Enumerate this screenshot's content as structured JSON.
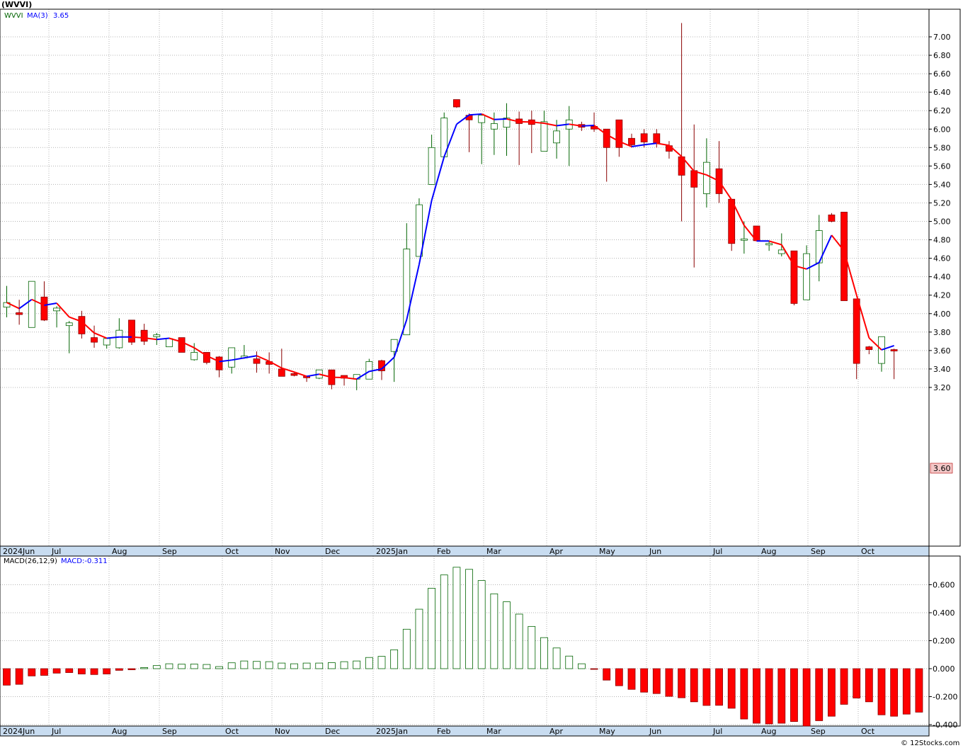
{
  "header": {
    "symbol": "(WVVI)"
  },
  "price_panel": {
    "legend_symbol": "WVVI",
    "legend_ma": "MA(3)",
    "legend_ma_value": "3.65",
    "last_price_tag": "3.60",
    "y_ticks": [
      "3.20",
      "3.40",
      "3.60",
      "3.80",
      "4.00",
      "4.20",
      "4.40",
      "4.60",
      "4.80",
      "5.00",
      "5.20",
      "5.40",
      "5.60",
      "5.80",
      "6.00",
      "6.20",
      "6.40",
      "6.60",
      "6.80",
      "7.00"
    ]
  },
  "macd_panel": {
    "legend_name": "MACD(26,12,9)",
    "legend_value": "MACD:-0.311",
    "y_ticks": [
      "-0.400",
      "-0.200",
      "0.000",
      "0.200",
      "0.400",
      "0.600"
    ]
  },
  "x_axis_labels": [
    "2024Jun",
    "Jul",
    "Aug",
    "Sep",
    "Oct",
    "Nov",
    "Dec",
    "2025Jan",
    "Feb",
    "Mar",
    "Apr",
    "May",
    "Jun",
    "Jul",
    "Aug",
    "Sep",
    "Oct"
  ],
  "footer": {
    "credit": "© 12Stocks.com"
  },
  "colors": {
    "up_candle": "#006400",
    "down_candle": "#ff0000",
    "ma_up": "#0000ff",
    "ma_down": "#ff0000",
    "grid": "#b4b4b4",
    "axis_band": "#c8dcf0",
    "price_tag": "#f4c8c8"
  },
  "chart_data": [
    {
      "type": "candlestick",
      "title": "(WVVI)",
      "series_name": "WVVI",
      "ylim": [
        3.15,
        7.25
      ],
      "ma_period": 3,
      "candles": [
        {
          "o": 4.07,
          "h": 4.3,
          "l": 3.96,
          "c": 4.12
        },
        {
          "o": 4.01,
          "h": 4.15,
          "l": 3.88,
          "c": 3.99
        },
        {
          "o": 3.85,
          "h": 4.35,
          "l": 3.85,
          "c": 4.35
        },
        {
          "o": 4.18,
          "h": 4.35,
          "l": 3.92,
          "c": 3.93
        },
        {
          "o": 4.03,
          "h": 4.08,
          "l": 3.85,
          "c": 4.06
        },
        {
          "o": 3.87,
          "h": 3.92,
          "l": 3.57,
          "c": 3.9
        },
        {
          "o": 3.97,
          "h": 4.03,
          "l": 3.73,
          "c": 3.78
        },
        {
          "o": 3.74,
          "h": 3.87,
          "l": 3.63,
          "c": 3.69
        },
        {
          "o": 3.66,
          "h": 3.74,
          "l": 3.62,
          "c": 3.73
        },
        {
          "o": 3.63,
          "h": 3.95,
          "l": 3.62,
          "c": 3.82
        },
        {
          "o": 3.93,
          "h": 3.93,
          "l": 3.66,
          "c": 3.69
        },
        {
          "o": 3.82,
          "h": 3.89,
          "l": 3.66,
          "c": 3.7
        },
        {
          "o": 3.75,
          "h": 3.79,
          "l": 3.66,
          "c": 3.77
        },
        {
          "o": 3.64,
          "h": 3.74,
          "l": 3.64,
          "c": 3.73
        },
        {
          "o": 3.74,
          "h": 3.74,
          "l": 3.58,
          "c": 3.58
        },
        {
          "o": 3.5,
          "h": 3.68,
          "l": 3.49,
          "c": 3.58
        },
        {
          "o": 3.58,
          "h": 3.58,
          "l": 3.45,
          "c": 3.47
        },
        {
          "o": 3.53,
          "h": 3.54,
          "l": 3.31,
          "c": 3.39
        },
        {
          "o": 3.42,
          "h": 3.63,
          "l": 3.35,
          "c": 3.63
        },
        {
          "o": 3.52,
          "h": 3.66,
          "l": 3.51,
          "c": 3.54
        },
        {
          "o": 3.51,
          "h": 3.59,
          "l": 3.36,
          "c": 3.46
        },
        {
          "o": 3.48,
          "h": 3.58,
          "l": 3.35,
          "c": 3.45
        },
        {
          "o": 3.4,
          "h": 3.62,
          "l": 3.32,
          "c": 3.32
        },
        {
          "o": 3.35,
          "h": 3.37,
          "l": 3.32,
          "c": 3.33
        },
        {
          "o": 3.32,
          "h": 3.33,
          "l": 3.26,
          "c": 3.31
        },
        {
          "o": 3.3,
          "h": 3.39,
          "l": 3.29,
          "c": 3.39
        },
        {
          "o": 3.39,
          "h": 3.39,
          "l": 3.18,
          "c": 3.23
        },
        {
          "o": 3.33,
          "h": 3.33,
          "l": 3.22,
          "c": 3.3
        },
        {
          "o": 3.29,
          "h": 3.34,
          "l": 3.17,
          "c": 3.34
        },
        {
          "o": 3.29,
          "h": 3.51,
          "l": 3.29,
          "c": 3.48
        },
        {
          "o": 3.49,
          "h": 3.5,
          "l": 3.28,
          "c": 3.38
        },
        {
          "o": 3.59,
          "h": 3.72,
          "l": 3.26,
          "c": 3.72
        },
        {
          "o": 3.77,
          "h": 4.98,
          "l": 3.77,
          "c": 4.7
        },
        {
          "o": 4.62,
          "h": 5.25,
          "l": 4.62,
          "c": 5.18
        },
        {
          "o": 5.4,
          "h": 5.94,
          "l": 5.4,
          "c": 5.8
        },
        {
          "o": 5.7,
          "h": 6.18,
          "l": 5.7,
          "c": 6.12
        },
        {
          "o": 6.32,
          "h": 6.32,
          "l": 6.23,
          "c": 6.24
        },
        {
          "o": 6.15,
          "h": 6.17,
          "l": 5.75,
          "c": 6.1
        },
        {
          "o": 6.07,
          "h": 6.16,
          "l": 5.62,
          "c": 6.15
        },
        {
          "o": 6.0,
          "h": 6.18,
          "l": 5.72,
          "c": 6.06
        },
        {
          "o": 6.02,
          "h": 6.28,
          "l": 5.71,
          "c": 6.12
        },
        {
          "o": 6.11,
          "h": 6.19,
          "l": 5.61,
          "c": 6.06
        },
        {
          "o": 6.1,
          "h": 6.2,
          "l": 5.74,
          "c": 6.05
        },
        {
          "o": 5.76,
          "h": 6.2,
          "l": 5.76,
          "c": 6.08
        },
        {
          "o": 5.85,
          "h": 6.1,
          "l": 5.68,
          "c": 5.98
        },
        {
          "o": 6.0,
          "h": 6.25,
          "l": 5.6,
          "c": 6.1
        },
        {
          "o": 6.05,
          "h": 6.08,
          "l": 5.98,
          "c": 6.02
        },
        {
          "o": 6.03,
          "h": 6.18,
          "l": 5.97,
          "c": 6.0
        },
        {
          "o": 6.0,
          "h": 6.0,
          "l": 5.43,
          "c": 5.8
        },
        {
          "o": 6.1,
          "h": 6.1,
          "l": 5.7,
          "c": 5.8
        },
        {
          "o": 5.9,
          "h": 5.95,
          "l": 5.8,
          "c": 5.83
        },
        {
          "o": 5.95,
          "h": 6.0,
          "l": 5.8,
          "c": 5.86
        },
        {
          "o": 5.95,
          "h": 6.0,
          "l": 5.8,
          "c": 5.85
        },
        {
          "o": 5.82,
          "h": 5.87,
          "l": 5.68,
          "c": 5.76
        },
        {
          "o": 5.7,
          "h": 7.15,
          "l": 5.0,
          "c": 5.5
        },
        {
          "o": 5.55,
          "h": 6.05,
          "l": 4.5,
          "c": 5.37
        },
        {
          "o": 5.3,
          "h": 5.9,
          "l": 5.15,
          "c": 5.64
        },
        {
          "o": 5.57,
          "h": 5.87,
          "l": 5.2,
          "c": 5.3
        },
        {
          "o": 5.24,
          "h": 5.24,
          "l": 4.68,
          "c": 4.76
        },
        {
          "o": 4.8,
          "h": 5.0,
          "l": 4.65,
          "c": 4.81
        },
        {
          "o": 4.95,
          "h": 4.95,
          "l": 4.79,
          "c": 4.79
        },
        {
          "o": 4.75,
          "h": 4.79,
          "l": 4.68,
          "c": 4.76
        },
        {
          "o": 4.65,
          "h": 4.87,
          "l": 4.62,
          "c": 4.69
        },
        {
          "o": 4.68,
          "h": 4.68,
          "l": 4.09,
          "c": 4.11
        },
        {
          "o": 4.15,
          "h": 4.74,
          "l": 4.15,
          "c": 4.65
        },
        {
          "o": 4.55,
          "h": 5.07,
          "l": 4.35,
          "c": 4.9
        },
        {
          "o": 5.07,
          "h": 5.09,
          "l": 4.99,
          "c": 5.0
        },
        {
          "o": 5.1,
          "h": 5.1,
          "l": 4.14,
          "c": 4.14
        },
        {
          "o": 4.16,
          "h": 4.16,
          "l": 3.29,
          "c": 3.46
        },
        {
          "o": 3.64,
          "h": 3.65,
          "l": 3.56,
          "c": 3.61
        },
        {
          "o": 3.46,
          "h": 3.75,
          "l": 3.37,
          "c": 3.75
        },
        {
          "o": 3.61,
          "h": 3.62,
          "l": 3.29,
          "c": 3.6
        }
      ]
    },
    {
      "type": "bar",
      "title": "MACD(26,12,9)",
      "series_name": "MACD",
      "ylim": [
        -0.4,
        0.7
      ],
      "values": [
        -0.118,
        -0.112,
        -0.052,
        -0.048,
        -0.032,
        -0.028,
        -0.038,
        -0.042,
        -0.038,
        -0.012,
        -0.008,
        0.008,
        0.022,
        0.035,
        0.032,
        0.033,
        0.03,
        0.015,
        0.042,
        0.055,
        0.052,
        0.05,
        0.04,
        0.035,
        0.04,
        0.04,
        0.043,
        0.05,
        0.055,
        0.08,
        0.088,
        0.135,
        0.282,
        0.425,
        0.575,
        0.67,
        0.725,
        0.71,
        0.63,
        0.535,
        0.478,
        0.39,
        0.302,
        0.222,
        0.148,
        0.09,
        0.035,
        -0.005,
        -0.082,
        -0.122,
        -0.148,
        -0.168,
        -0.178,
        -0.198,
        -0.208,
        -0.237,
        -0.263,
        -0.262,
        -0.283,
        -0.36,
        -0.39,
        -0.395,
        -0.39,
        -0.378,
        -0.41,
        -0.372,
        -0.34,
        -0.255,
        -0.21,
        -0.237,
        -0.33,
        -0.34,
        -0.325,
        -0.311
      ]
    }
  ]
}
